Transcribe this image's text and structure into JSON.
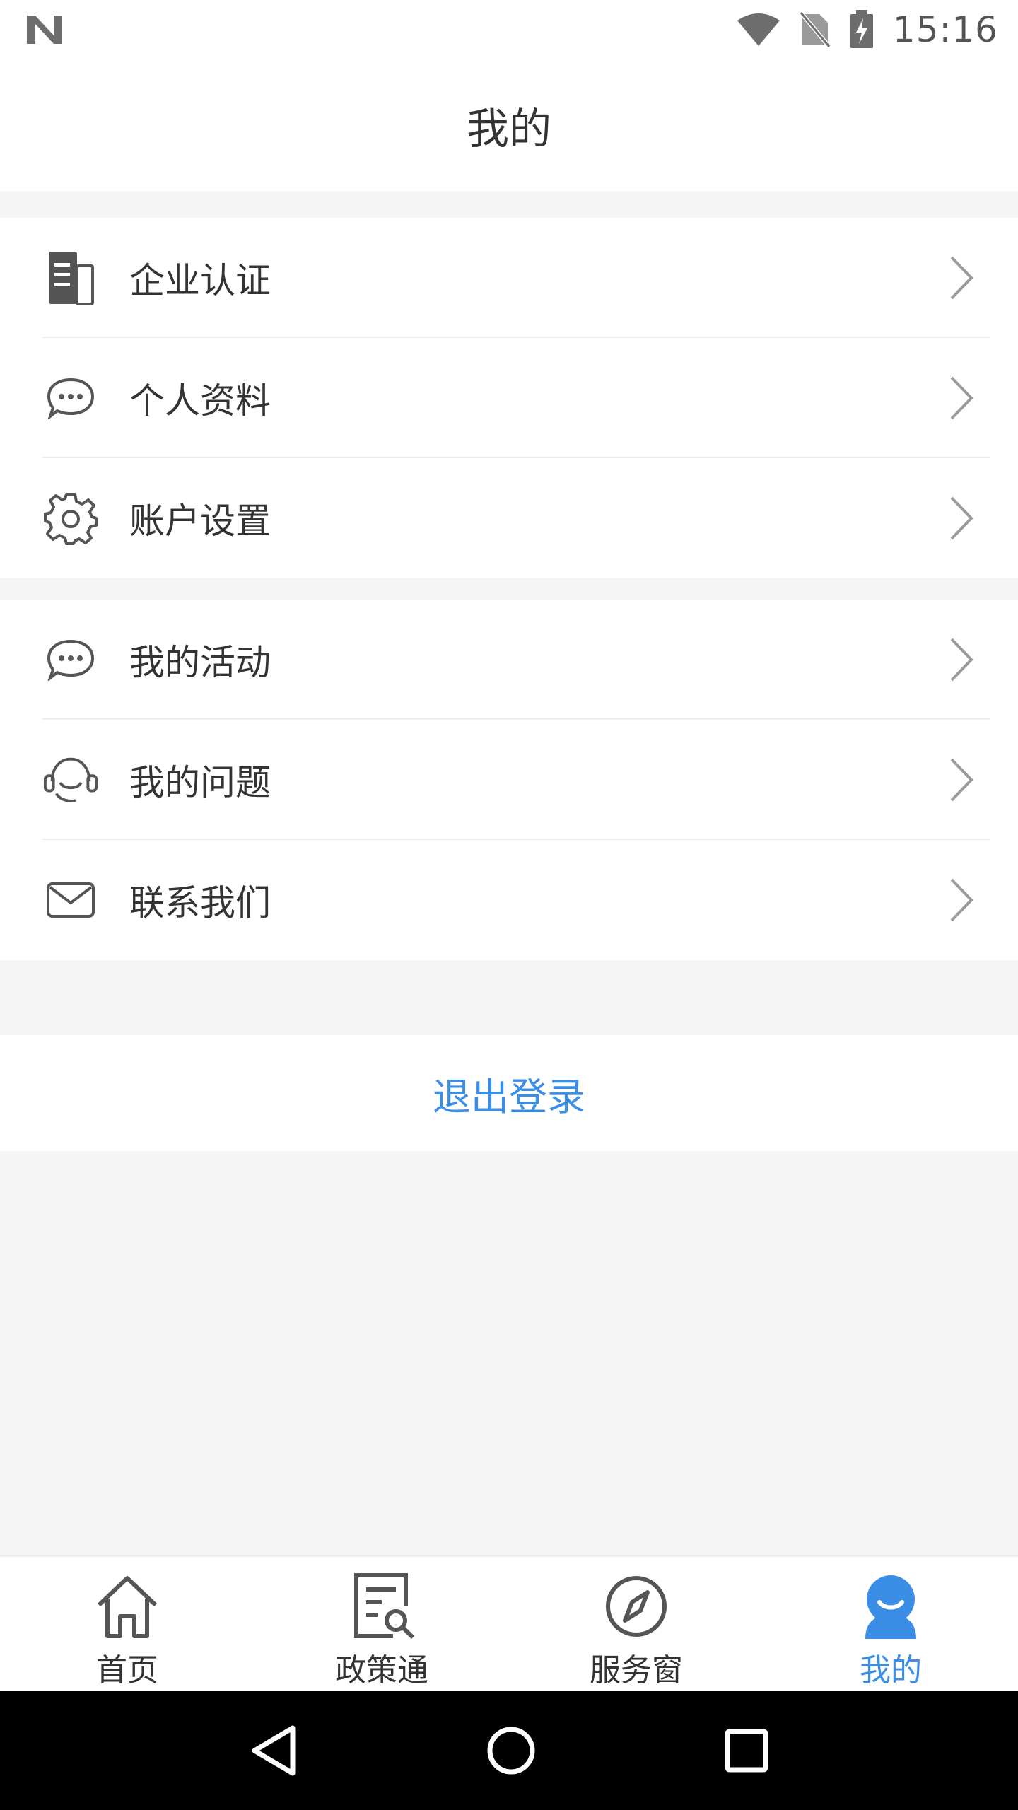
{
  "status_bar": {
    "time": "15:16",
    "icons": [
      "n-logo-icon",
      "wifi-icon",
      "no-sim-icon",
      "battery-charging-icon"
    ]
  },
  "header": {
    "title": "我的"
  },
  "menu_groups": [
    {
      "items": [
        {
          "label": "企业认证",
          "icon": "building-document-icon"
        },
        {
          "label": "个人资料",
          "icon": "chat-bubble-icon"
        },
        {
          "label": "账户设置",
          "icon": "gear-icon"
        }
      ]
    },
    {
      "items": [
        {
          "label": "我的活动",
          "icon": "chat-bubble-icon"
        },
        {
          "label": "我的问题",
          "icon": "headset-support-icon"
        },
        {
          "label": "联系我们",
          "icon": "envelope-icon"
        }
      ]
    }
  ],
  "logout": {
    "label": "退出登录"
  },
  "bottom_nav": {
    "items": [
      {
        "label": "首页",
        "icon": "home-icon",
        "active": false
      },
      {
        "label": "政策通",
        "icon": "document-search-icon",
        "active": false
      },
      {
        "label": "服务窗",
        "icon": "compass-icon",
        "active": false
      },
      {
        "label": "我的",
        "icon": "user-icon",
        "active": true
      }
    ]
  },
  "colors": {
    "accent": "#3a8ee6",
    "text": "#333333",
    "background": "#f5f5f5",
    "divider": "#eeeeee"
  }
}
